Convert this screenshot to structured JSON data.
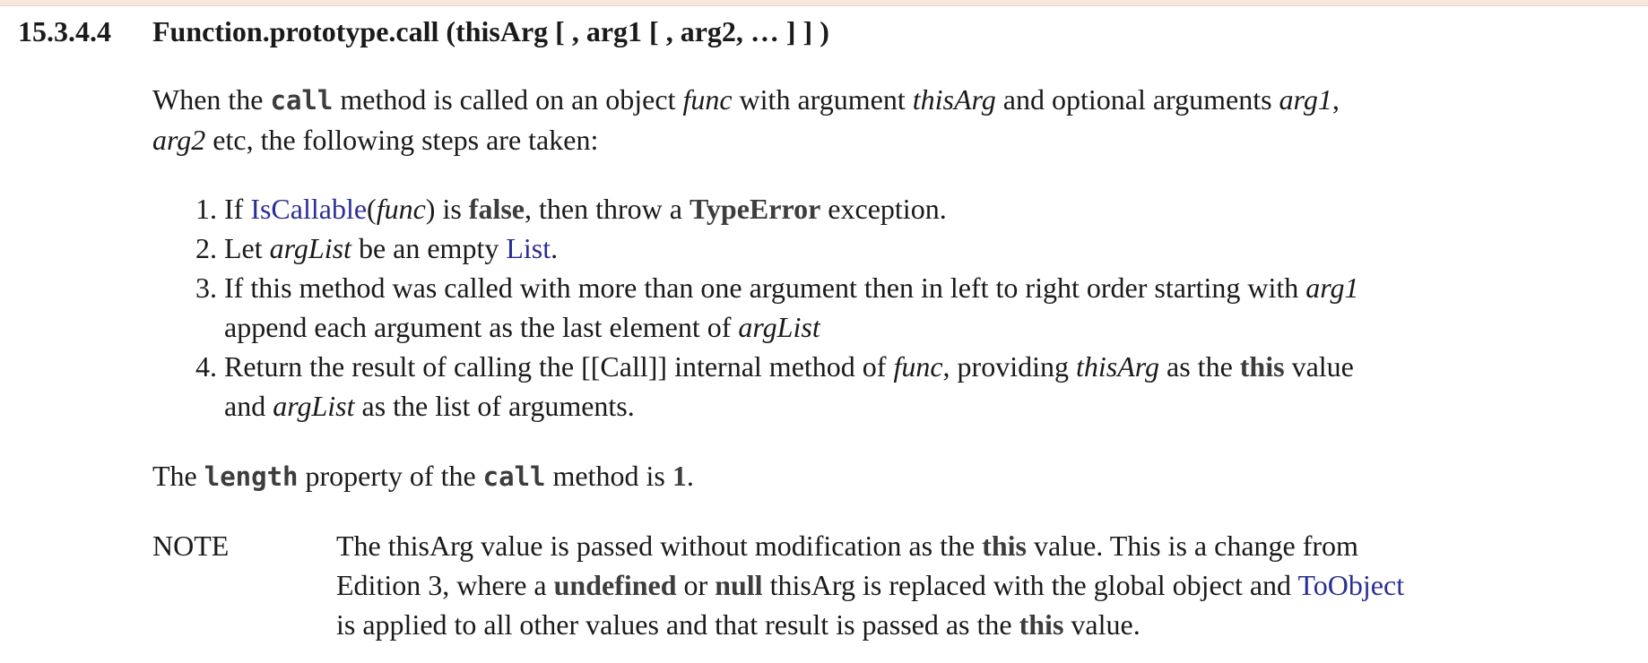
{
  "section": {
    "number": "15.3.4.4",
    "title": "Function.prototype.call (thisArg [ , arg1 [ , arg2, … ] ] )"
  },
  "intro": {
    "t1": "When the ",
    "code_call": "call",
    "t2": " method is called on an object ",
    "func": "func",
    "t3": " with argument ",
    "thisArg": "thisArg",
    "t4": " and optional arguments ",
    "arg1": "arg1",
    "t5": ",",
    "arg2": "arg2",
    "t6": " etc, the following steps are taken:"
  },
  "steps": {
    "s1": {
      "num": "1.",
      "t1": "If ",
      "link": "IsCallable",
      "t2": "(",
      "func": "func",
      "t3": ") is ",
      "kw_false": "false",
      "t4": ", then throw a ",
      "kw_type": "TypeError",
      "t5": " exception."
    },
    "s2": {
      "num": "2.",
      "t1": "Let ",
      "argList": "argList",
      "t2": " be an empty ",
      "link": "List",
      "t3": "."
    },
    "s3": {
      "num": "3.",
      "t1": "If this method was called with more than one argument then in left to right order starting with ",
      "arg1": "arg1",
      "t2": "append each argument as the last element of ",
      "argList": "argList"
    },
    "s4": {
      "num": "4.",
      "t1": "Return the result of calling the [[Call]] internal method of ",
      "func": "func",
      "t2": ", providing ",
      "thisArg": "thisArg",
      "t3": " as the ",
      "kw_this": "this",
      "t4": " value",
      "t5": "and ",
      "argList": "argList",
      "t6": " as the list of arguments."
    }
  },
  "length": {
    "t1": "The ",
    "code_length": "length",
    "t2": " property of the ",
    "code_call": "call",
    "t3": " method is ",
    "value": "1",
    "t4": "."
  },
  "note": {
    "label": "NOTE",
    "l1_t1": "The thisArg value is passed without modification as the ",
    "l1_kw": "this",
    "l1_t2": " value. This is a change from",
    "l2_t1": "Edition 3, where a ",
    "l2_kw1": "undefined",
    "l2_t2": " or ",
    "l2_kw2": "null",
    "l2_t3": " thisArg is replaced with the global object and ",
    "l2_link": "ToObject",
    "l3_t1": "is applied to all other values and that result is passed as the ",
    "l3_kw": "this",
    "l3_t2": " value."
  }
}
